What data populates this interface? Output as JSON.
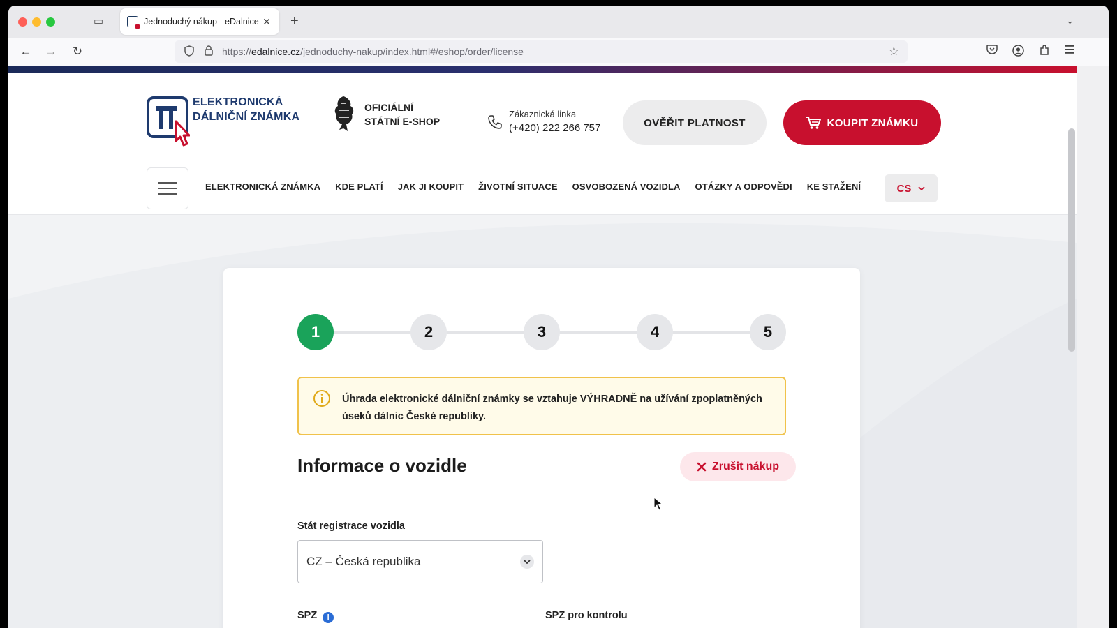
{
  "browser": {
    "tab_title": "Jednoduchý nákup - eDalnice",
    "url_prefix": "https://",
    "url_host": "edalnice.cz",
    "url_path": "/jednoduchy-nakup/index.html#/eshop/order/license"
  },
  "header": {
    "logo_line1": "ELEKTRONICKÁ",
    "logo_line2": "DÁLNIČNÍ ZNÁMKA",
    "eshop_line1": "OFICIÁLNÍ",
    "eshop_line2": "STÁTNÍ E-SHOP",
    "phone_label": "Zákaznická linka",
    "phone_number": "(+420) 222 266 757",
    "verify_label": "OVĚŘIT PLATNOST",
    "buy_label": "KOUPIT ZNÁMKU"
  },
  "nav": {
    "items": [
      "ELEKTRONICKÁ ZNÁMKA",
      "KDE PLATÍ",
      "JAK JI KOUPIT",
      "ŽIVOTNÍ SITUACE",
      "OSVOBOZENÁ VOZIDLA",
      "OTÁZKY A ODPOVĚDI",
      "KE STAŽENÍ"
    ],
    "language": "CS"
  },
  "wizard": {
    "steps": [
      "1",
      "2",
      "3",
      "4",
      "5"
    ],
    "active_step": 1
  },
  "alert": {
    "text": "Úhrada elektronické dálniční známky se vztahuje VÝHRADNĚ na užívání zpoplatněných úseků dálnic České republiky."
  },
  "form": {
    "title": "Informace o vozidle",
    "cancel_label": "Zrušit nákup",
    "country_label": "Stát registrace vozidla",
    "country_value": "CZ – Česká republika",
    "spz_label": "SPZ",
    "spz_confirm_label": "SPZ pro kontrolu"
  },
  "colors": {
    "brand_red": "#c8102e",
    "brand_navy": "#1e3a6e",
    "step_active": "#1aa35a",
    "alert_border": "#f0c24b"
  }
}
